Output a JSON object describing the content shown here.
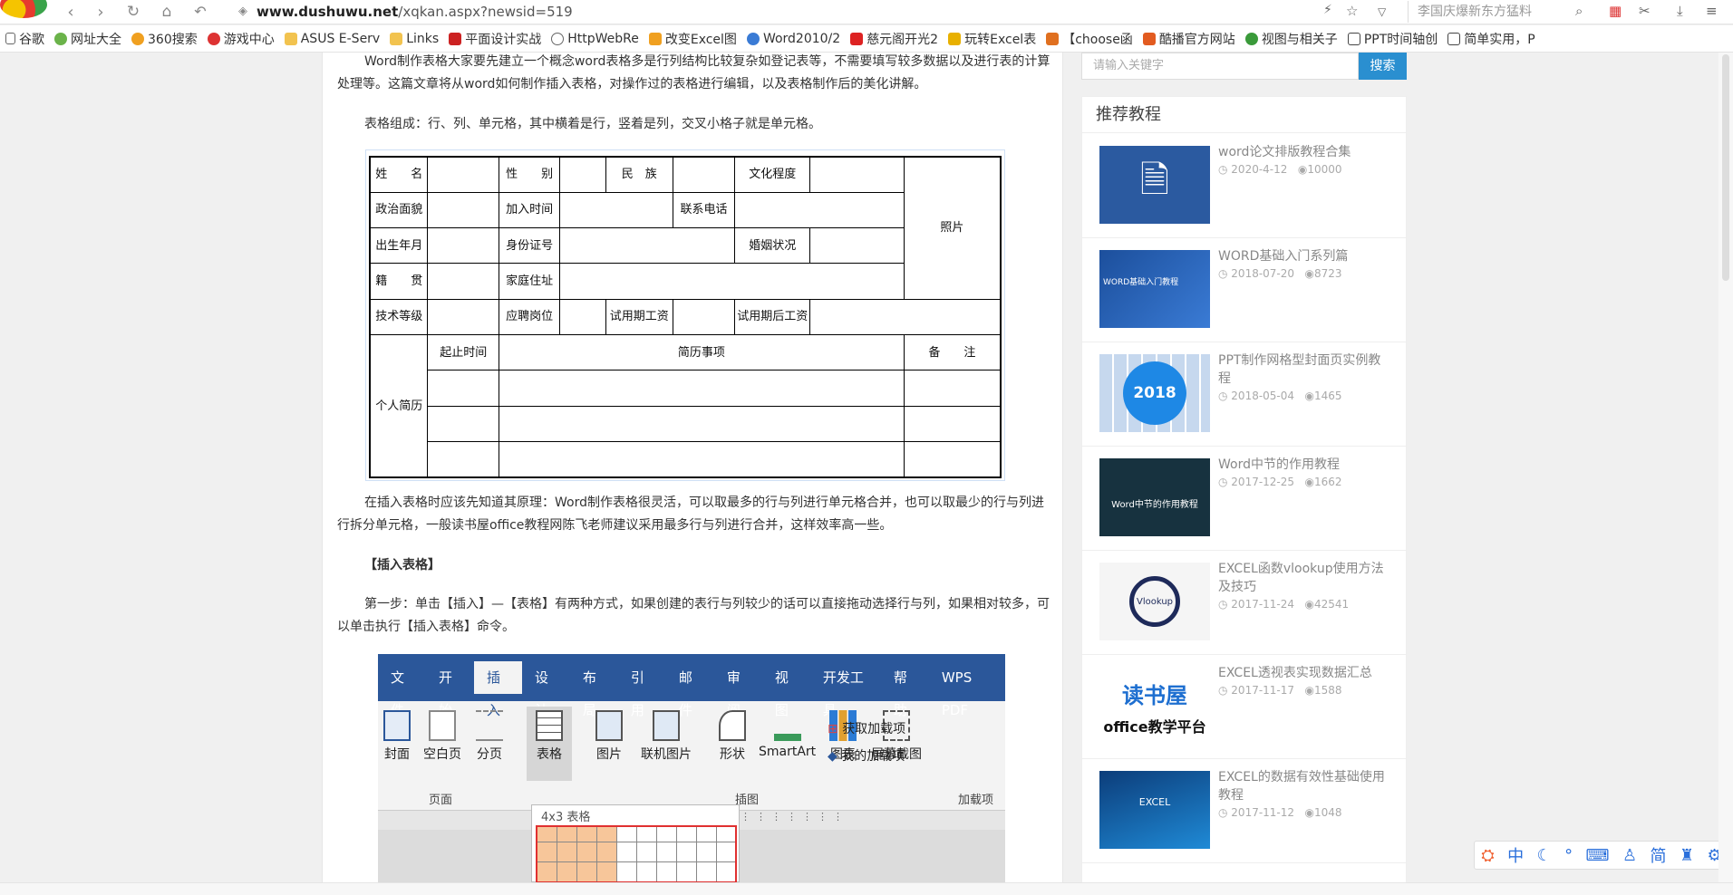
{
  "browser": {
    "url_domain": "www.dushuwu.net",
    "url_path": "/xqkan.aspx?newsid=519",
    "search_placeholder": "李国庆爆新东方猛料"
  },
  "bookmarks": [
    "谷歌",
    "网址大全",
    "360搜索",
    "游戏中心",
    "ASUS E-Serv",
    "Links",
    "平面设计实战",
    "HttpWebRe",
    "改变Excel图",
    "Word2010/2",
    "慈元阁开光2",
    "玩转Excel表",
    "【choose函",
    "酷播官方网站",
    "视图与相关子",
    "PPT时间轴创",
    "简单实用，P"
  ],
  "article": {
    "p1": "Word制作表格大家要先建立一个概念word表格多是行列结构比较复杂如登记表等，不需要填写较多数据以及进行表的计算处理等。这篇文章将从word如何制作插入表格，对操作过的表格进行编辑，以及表格制作后的美化讲解。",
    "p2": "表格组成：行、列、单元格，其中横着是行，竖着是列，交叉小格子就是单元格。",
    "p3": "在插入表格时应该先知道其原理：Word制作表格很灵活，可以取最多的行与列进行单元格合并，也可以取最少的行与列进行拆分单元格，一般读书屋office教程网陈飞老师建议采用最多行与列进行合并，这样效率高一些。",
    "h1": "【插入表格】",
    "p4": "第一步：单击【插入】—【表格】有两种方式，如果创建的表行与列较少的话可以直接拖动选择行与列，如果相对较多，可以单击执行【插入表格】命令。"
  },
  "form": {
    "name": "姓　　名",
    "gender": "性　　别",
    "ethnic": "民　族",
    "edu": "文化程度",
    "photo": "照片",
    "politics": "政治面貌",
    "join": "加入时间",
    "phone": "联系电话",
    "birth": "出生年月",
    "id": "身份证号",
    "marital": "婚姻状况",
    "native": "籍　　贯",
    "address": "家庭住址",
    "tech": "技术等级",
    "post": "应聘岗位",
    "trial": "试用期工资",
    "after": "试用期后工资",
    "resume": "个人简历",
    "period": "起止时间",
    "events": "简历事项",
    "remark": "备　　注"
  },
  "ribbon": {
    "tabs": [
      "文件",
      "开始",
      "插入",
      "设计",
      "布局",
      "引用",
      "邮件",
      "审阅",
      "视图",
      "开发工具",
      "帮助",
      "WPS PDF"
    ],
    "buttons": [
      "封面",
      "空白页",
      "分页",
      "表格",
      "图片",
      "联机图片",
      "形状",
      "SmartArt",
      "图表",
      "屏幕截图"
    ],
    "addin1": "获取加载项",
    "addin2": "我的加载项",
    "group_pages": "页面",
    "group_illust": "插图",
    "group_addins": "加载项",
    "grid_label": "4x3 表格"
  },
  "sidebar": {
    "search_placeholder": "请输入关键字",
    "search_button": "搜索",
    "title": "推荐教程",
    "items": [
      {
        "title": "word论文排版教程合集",
        "date": "2020-4-12",
        "views": "10000"
      },
      {
        "title": "WORD基础入门系列篇",
        "date": "2018-07-20",
        "views": "8723"
      },
      {
        "title": "PPT制作网格型封面页实例教程",
        "date": "2018-05-04",
        "views": "1465"
      },
      {
        "title": "Word中节的作用教程",
        "date": "2017-12-25",
        "views": "1662"
      },
      {
        "title": "EXCEL函数vlookup使用方法及技巧",
        "date": "2017-11-24",
        "views": "42541"
      },
      {
        "title": "EXCEL透视表实现数据汇总",
        "date": "2017-11-17",
        "views": "1588"
      },
      {
        "title": "EXCEL的数据有效性基础使用教程",
        "date": "2017-11-12",
        "views": "1048"
      }
    ]
  },
  "thumbs": {
    "t2": "WORD基础入门教程",
    "t3": "2018",
    "t4": "Word中节的作用教程",
    "t5": "Vlookup",
    "t6a": "读书屋",
    "t6b": "office教学平台",
    "t7": "EXCEL"
  },
  "ime": [
    "中",
    "简"
  ]
}
